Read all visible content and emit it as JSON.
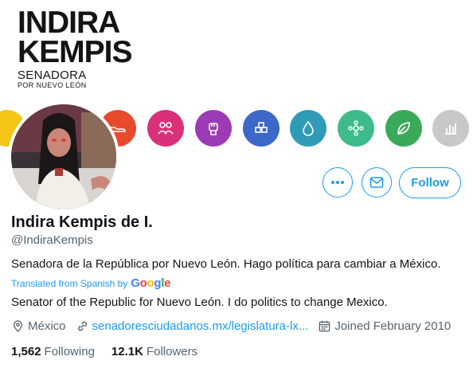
{
  "banner": {
    "brand_line1": "INDIRA",
    "brand_line2": "KEMPIS",
    "brand_sub1": "SENADORA",
    "brand_sub2": "POR NUEVO LEÓN",
    "icons": [
      {
        "name": "yellow-circle-icon",
        "color": "#f5c518"
      },
      {
        "name": "shoe-icon",
        "color": "#e84b2c"
      },
      {
        "name": "people-icon",
        "color": "#d9307a"
      },
      {
        "name": "fist-icon",
        "color": "#9c3bb5"
      },
      {
        "name": "cubes-icon",
        "color": "#3d67c8"
      },
      {
        "name": "water-drop-icon",
        "color": "#2f9bb8"
      },
      {
        "name": "flower-icon",
        "color": "#3dbb8a"
      },
      {
        "name": "leaf-icon",
        "color": "#3aa95a"
      },
      {
        "name": "bar-chart-icon",
        "color": "#c8c8c8"
      }
    ]
  },
  "profile": {
    "name": "Indira Kempis de I.",
    "handle": "@IndiraKempis",
    "bio": "Senadora de la República por Nuevo León. Hago política para cambiar a México.",
    "translated_label": "Translated from Spanish by",
    "translated_provider": "Google",
    "bio_translated": "Senator of the Republic for Nuevo León. I do politics to change Mexico.",
    "location": "México",
    "website": "senadoresciudadanos.mx/legislatura-lx...",
    "joined": "Joined February 2010"
  },
  "actions": {
    "more_label": "More",
    "message_label": "Message",
    "follow_label": "Follow"
  },
  "stats": {
    "following_count": "1,562",
    "following_label": "Following",
    "followers_count": "12.1K",
    "followers_label": "Followers"
  },
  "colors": {
    "accent": "#1d9bf0",
    "secondary_text": "#536471",
    "primary_text": "#0f1419"
  }
}
